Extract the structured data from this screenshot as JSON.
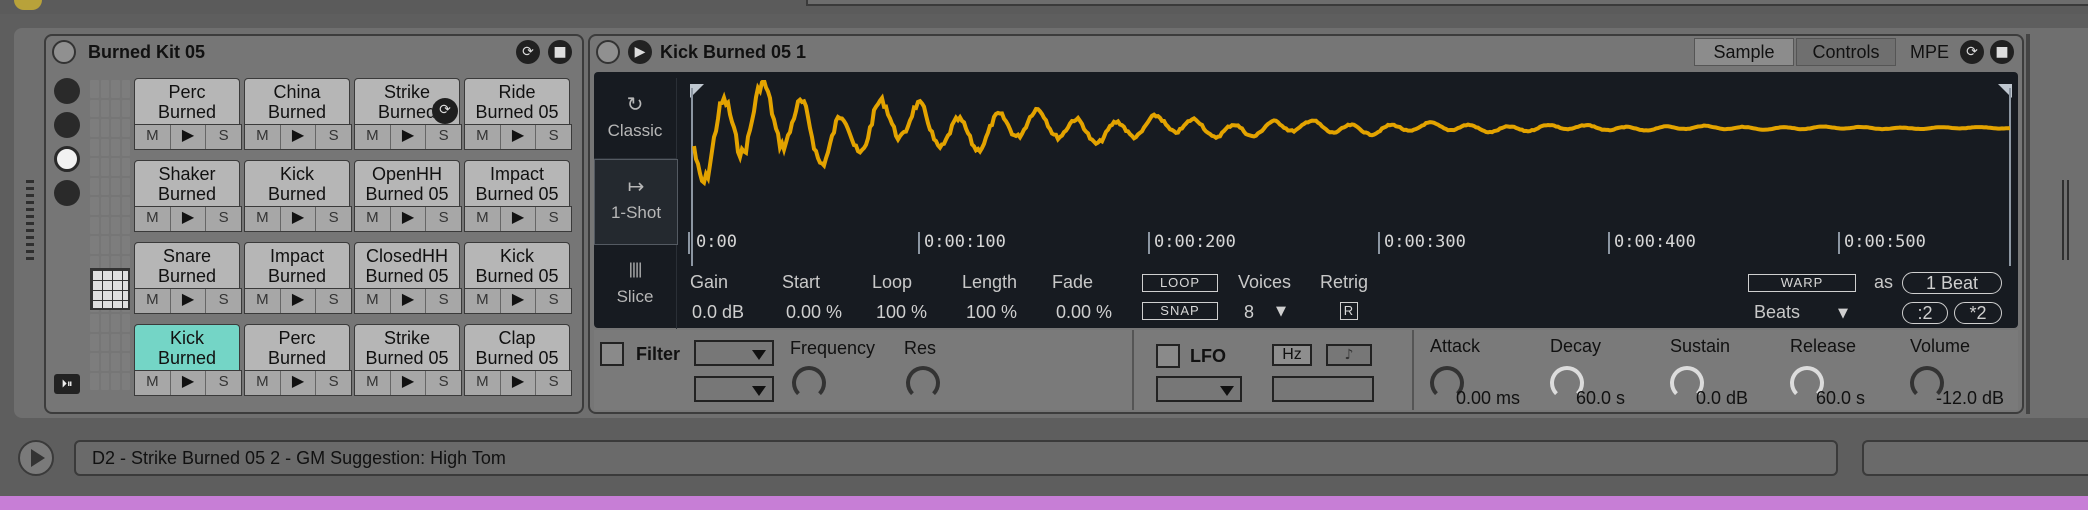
{
  "drum_rack": {
    "title": "Burned Kit 05",
    "pads": [
      {
        "line1": "Perc",
        "line2": "Burned",
        "m": "M",
        "play": "▶",
        "s": "S",
        "selected": false
      },
      {
        "line1": "China",
        "line2": "Burned",
        "m": "M",
        "play": "▶",
        "s": "S",
        "selected": false
      },
      {
        "line1": "Strike",
        "line2": "Burned",
        "m": "M",
        "play": "▶",
        "s": "S",
        "selected": false
      },
      {
        "line1": "Ride",
        "line2": "Burned 05",
        "m": "M",
        "play": "▶",
        "s": "S",
        "selected": false
      },
      {
        "line1": "Shaker",
        "line2": "Burned",
        "m": "M",
        "play": "▶",
        "s": "S",
        "selected": false
      },
      {
        "line1": "Kick",
        "line2": "Burned",
        "m": "M",
        "play": "▶",
        "s": "S",
        "selected": false
      },
      {
        "line1": "OpenHH",
        "line2": "Burned 05",
        "m": "M",
        "play": "▶",
        "s": "S",
        "selected": false
      },
      {
        "line1": "Impact",
        "line2": "Burned 05",
        "m": "M",
        "play": "▶",
        "s": "S",
        "selected": false
      },
      {
        "line1": "Snare",
        "line2": "Burned",
        "m": "M",
        "play": "▶",
        "s": "S",
        "selected": false
      },
      {
        "line1": "Impact",
        "line2": "Burned",
        "m": "M",
        "play": "▶",
        "s": "S",
        "selected": false
      },
      {
        "line1": "ClosedHH",
        "line2": "Burned 05",
        "m": "M",
        "play": "▶",
        "s": "S",
        "selected": false
      },
      {
        "line1": "Kick",
        "line2": "Burned 05",
        "m": "M",
        "play": "▶",
        "s": "S",
        "selected": false
      },
      {
        "line1": "Kick",
        "line2": "Burned",
        "m": "M",
        "play": "▶",
        "s": "S",
        "selected": true
      },
      {
        "line1": "Perc",
        "line2": "Burned",
        "m": "M",
        "play": "▶",
        "s": "S",
        "selected": false
      },
      {
        "line1": "Strike",
        "line2": "Burned 05",
        "m": "M",
        "play": "▶",
        "s": "S",
        "selected": false
      },
      {
        "line1": "Clap",
        "line2": "Burned 05",
        "m": "M",
        "play": "▶",
        "s": "S",
        "selected": false
      }
    ]
  },
  "sampler": {
    "title": "Kick Burned 05 1",
    "tabs": {
      "sample": "Sample",
      "controls": "Controls",
      "mpe": "MPE"
    },
    "modes": [
      {
        "label": "Classic",
        "icon": "loop-icon"
      },
      {
        "label": "1-Shot",
        "icon": "arrow-right-bar-icon"
      },
      {
        "label": "Slice",
        "icon": "slice-icon"
      }
    ],
    "timeline": [
      "0:00",
      "0:00:100",
      "0:00:200",
      "0:00:300",
      "0:00:400",
      "0:00:500"
    ],
    "params": [
      {
        "label": "Gain",
        "value": "0.0 dB"
      },
      {
        "label": "Start",
        "value": "0.00 %"
      },
      {
        "label": "Loop",
        "value": "100 %"
      },
      {
        "label": "Length",
        "value": "100 %"
      },
      {
        "label": "Fade",
        "value": "0.00 %"
      }
    ],
    "loop_toggle": "LOOP",
    "snap_toggle": "SNAP",
    "voices_label": "Voices",
    "voices_value": "8",
    "retrig_label": "Retrig",
    "retrig_value": "R",
    "warp_toggle": "WARP",
    "as_label": "as",
    "beat_value": "1 Beat",
    "warp_mode": "Beats",
    "div2": ":2",
    "mul2": "*2",
    "filter_label": "Filter",
    "frequency_label": "Frequency",
    "res_label": "Res",
    "lfo_label": "LFO",
    "hz_label": "Hz",
    "note_symbol": "♪",
    "envelope": [
      {
        "label": "Attack",
        "value": "0.00 ms"
      },
      {
        "label": "Decay",
        "value": "60.0 s"
      },
      {
        "label": "Sustain",
        "value": "0.0 dB"
      },
      {
        "label": "Release",
        "value": "60.0 s"
      },
      {
        "label": "Volume",
        "value": "-12.0 dB"
      }
    ],
    "wave_color": "#e3a300"
  },
  "status": {
    "text": "D2 - Strike Burned 05 2 - GM Suggestion: High Tom"
  }
}
